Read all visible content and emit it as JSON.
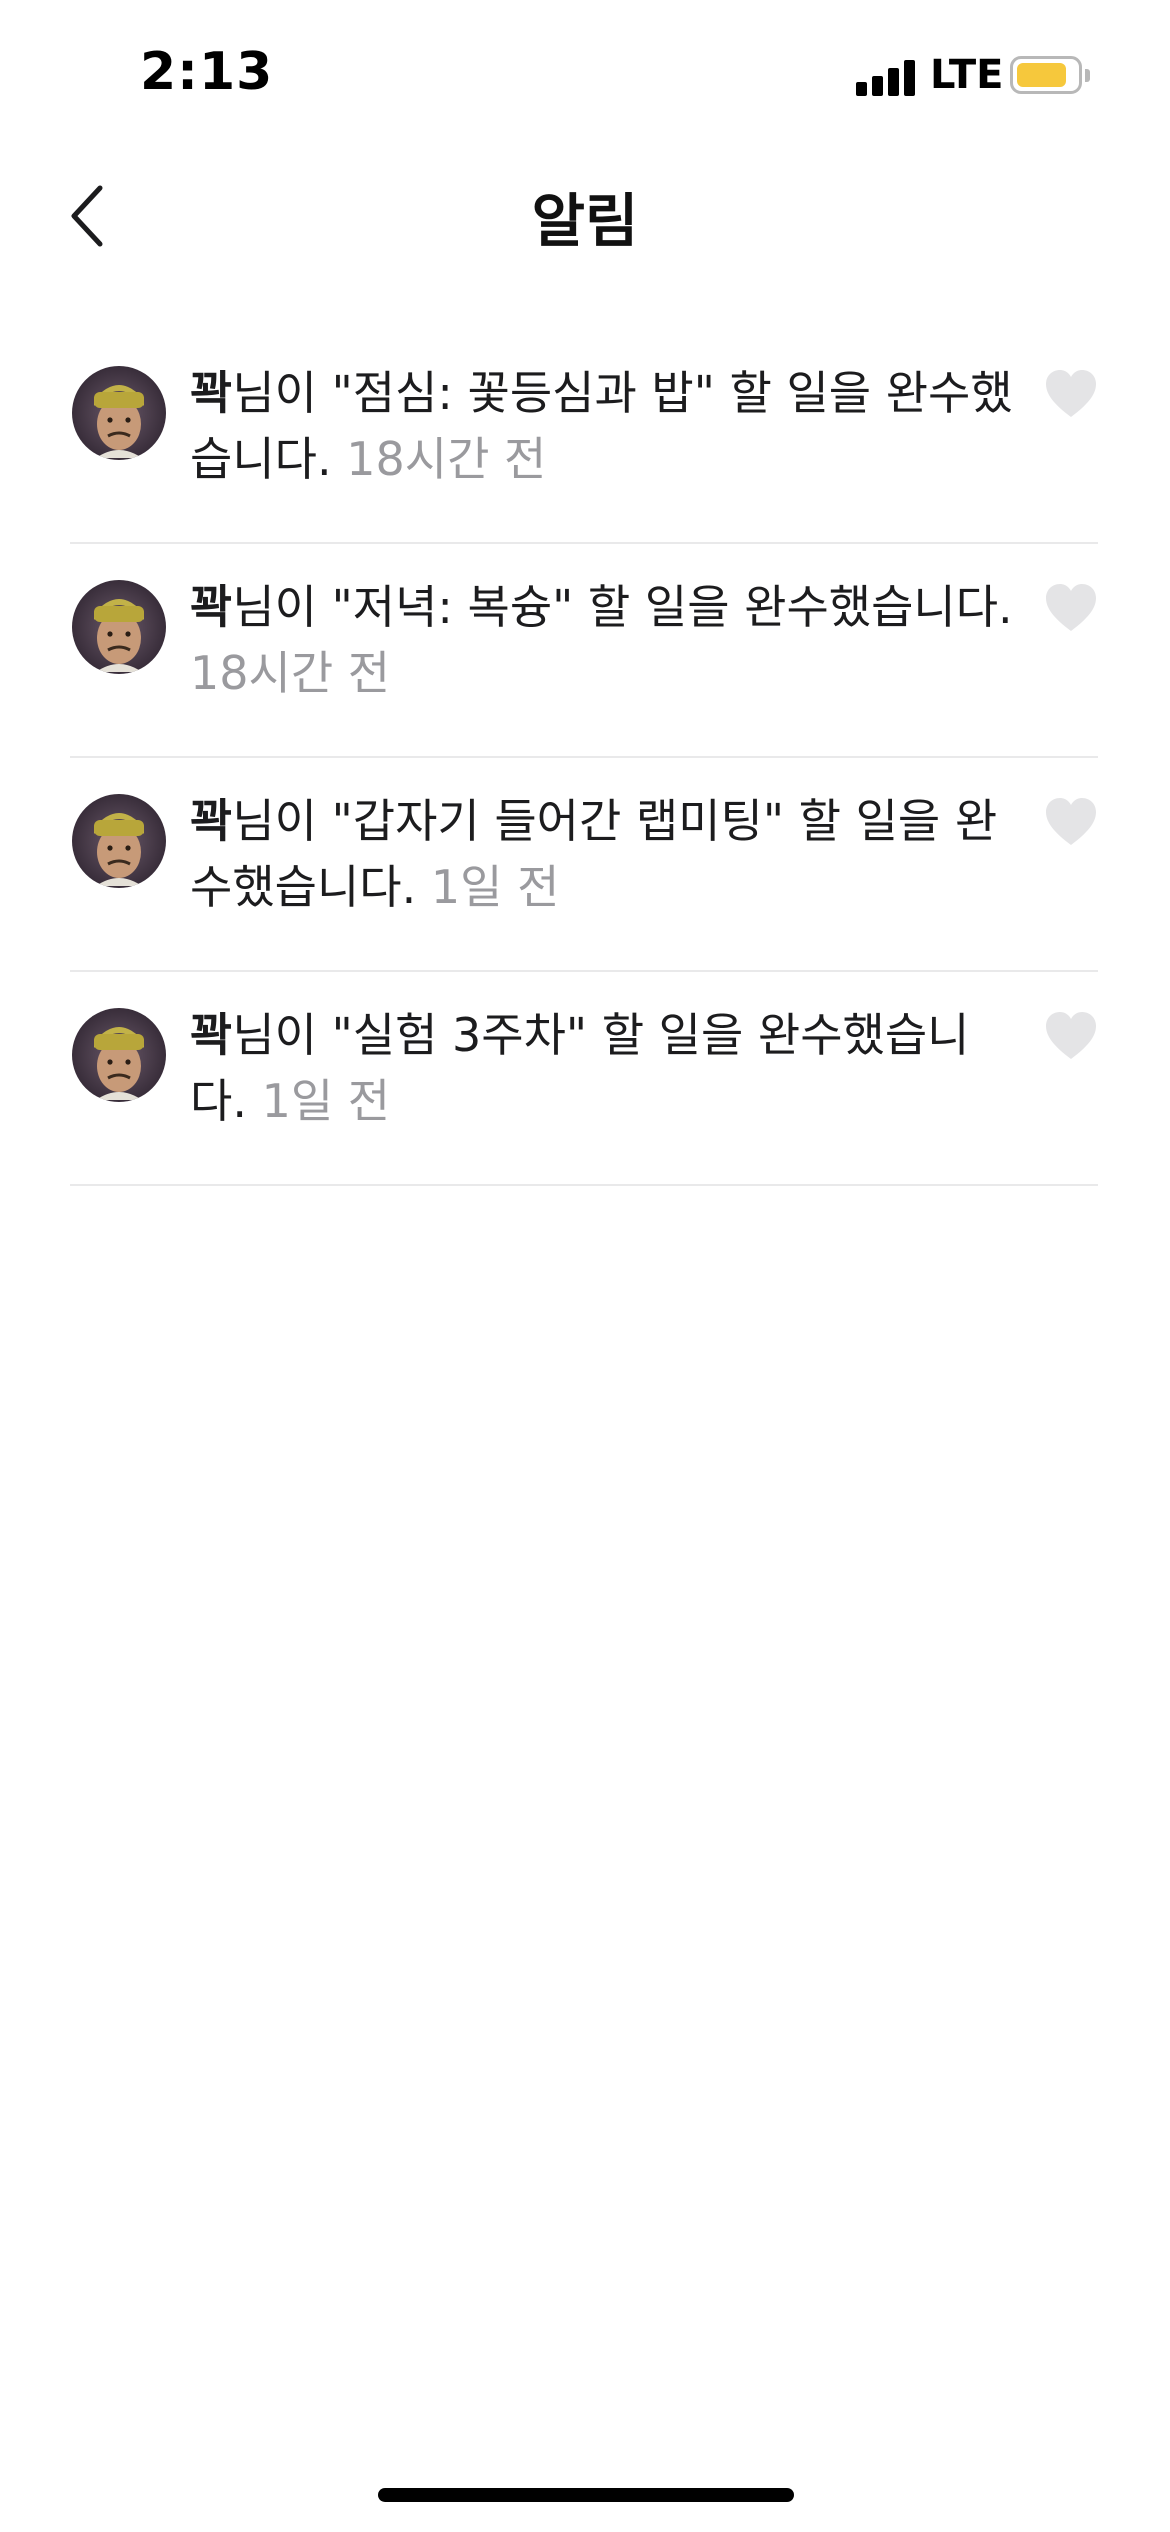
{
  "status_bar": {
    "time": "2:13",
    "network": "LTE",
    "battery_level": 0.85,
    "battery_color": "#f6c83c",
    "signal_icon": "cellular-signal-icon"
  },
  "header": {
    "title": "알림",
    "back_icon": "chevron-left-icon"
  },
  "notifications": [
    {
      "user": "꽉",
      "message": "님이 \"점심: 꽃등심과 밥\" 할 일을 완수했습니다. ",
      "time": "18시간 전",
      "like_icon": "heart-icon"
    },
    {
      "user": "꽉",
      "message": "님이 \"저녁: 복슝\" 할 일을 완수했습니다. ",
      "time": "18시간 전",
      "like_icon": "heart-icon"
    },
    {
      "user": "꽉",
      "message": "님이 \"갑자기 들어간 랩미팅\" 할 일을 완수했습니다. ",
      "time": "1일 전",
      "like_icon": "heart-icon"
    },
    {
      "user": "꽉",
      "message": "님이 \"실험 3주차\" 할 일을 완수했습니다. ",
      "time": "1일 전",
      "like_icon": "heart-icon"
    }
  ],
  "colors": {
    "time_text": "#9a9a9e",
    "divider": "#e9e9ea",
    "heart_inactive": "#e4e4e6"
  }
}
